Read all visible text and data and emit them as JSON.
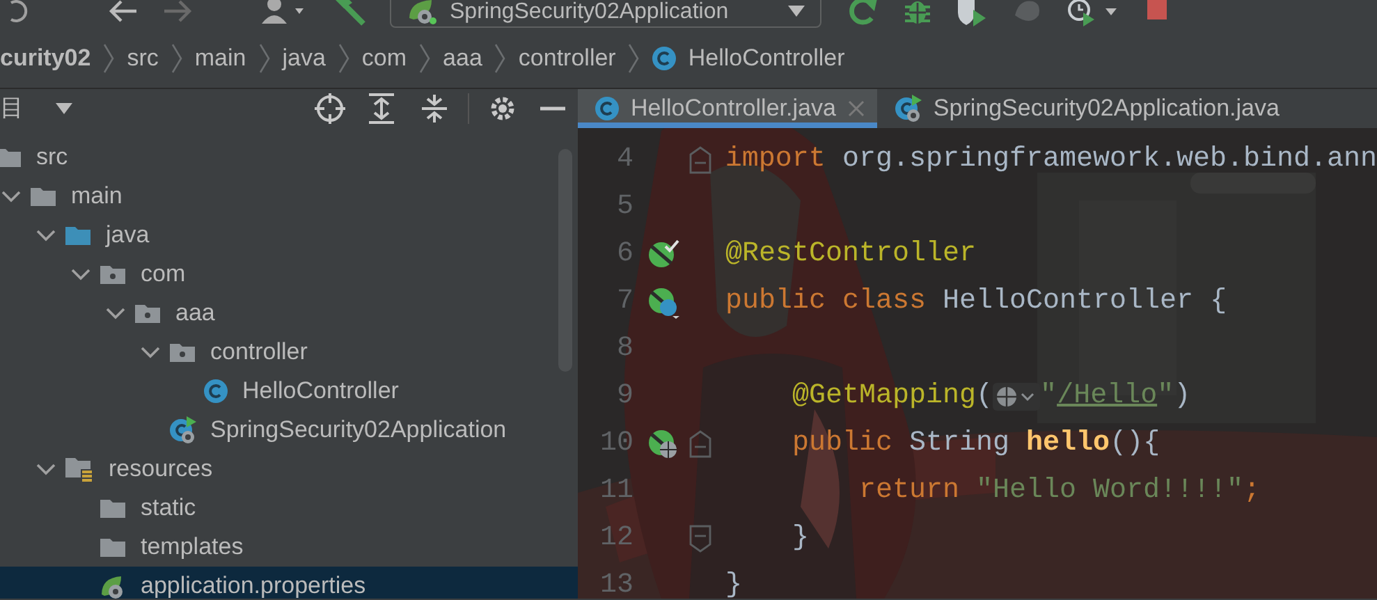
{
  "toolbar": {
    "run_config": "SpringSecurity02Application"
  },
  "breadcrumb": [
    {
      "text": "curity02",
      "kind": "project"
    },
    {
      "text": "src",
      "kind": "dir"
    },
    {
      "text": "main",
      "kind": "dir"
    },
    {
      "text": "java",
      "kind": "dir"
    },
    {
      "text": "com",
      "kind": "dir"
    },
    {
      "text": "aaa",
      "kind": "dir"
    },
    {
      "text": "controller",
      "kind": "dir"
    },
    {
      "text": "HelloController",
      "kind": "class"
    }
  ],
  "project_panel": {
    "title": "目",
    "tree": [
      {
        "label": "src",
        "kind": "folder",
        "selected": false,
        "children": [
          {
            "label": "main",
            "kind": "folder",
            "expanded": true,
            "selected": false,
            "children": [
              {
                "label": "java",
                "kind": "source-folder",
                "expanded": true,
                "selected": false,
                "children": [
                  {
                    "label": "com",
                    "kind": "package",
                    "expanded": true,
                    "selected": false,
                    "children": [
                      {
                        "label": "aaa",
                        "kind": "package",
                        "expanded": true,
                        "selected": false,
                        "children": [
                          {
                            "label": "controller",
                            "kind": "package",
                            "expanded": true,
                            "selected": false,
                            "children": [
                              {
                                "label": "HelloController",
                                "kind": "class",
                                "selected": false
                              }
                            ]
                          },
                          {
                            "label": "SpringSecurity02Application",
                            "kind": "spring-app",
                            "selected": false
                          }
                        ]
                      }
                    ]
                  }
                ]
              },
              {
                "label": "resources",
                "kind": "resources-folder",
                "expanded": true,
                "selected": false,
                "children": [
                  {
                    "label": "static",
                    "kind": "folder",
                    "selected": false
                  },
                  {
                    "label": "templates",
                    "kind": "folder",
                    "selected": false
                  },
                  {
                    "label": "application.properties",
                    "kind": "properties",
                    "selected": true
                  }
                ]
              }
            ]
          }
        ]
      }
    ]
  },
  "tabs": [
    {
      "label": "HelloController.java",
      "kind": "class",
      "selected": true
    },
    {
      "label": "SpringSecurity02Application.java",
      "kind": "spring-app",
      "selected": false
    }
  ],
  "editor": {
    "lines": [
      {
        "number": "4",
        "fold_marker": {
          "kind": "start"
        },
        "tokens": [
          {
            "kind": "keyword",
            "text": "import"
          },
          {
            "kind": "plain",
            "text": " org.springframework.web.bind.ann"
          }
        ]
      },
      {
        "number": "5"
      },
      {
        "number": "6",
        "gutter_icon": {
          "kind": "bean-check"
        },
        "tokens": [
          {
            "kind": "annotation",
            "text": "@RestController"
          }
        ]
      },
      {
        "number": "7",
        "gutter_icon": {
          "kind": "bean-class"
        },
        "tokens": [
          {
            "kind": "keyword",
            "text": "public class"
          },
          {
            "kind": "plain",
            "text": " HelloController {"
          }
        ]
      },
      {
        "number": "8"
      },
      {
        "number": "9",
        "tokens": [
          {
            "kind": "annotation",
            "text": "    @GetMapping"
          },
          {
            "kind": "plain",
            "text": "("
          },
          {
            "kind": "globe-icon"
          },
          {
            "kind": "string",
            "text": "\""
          },
          {
            "kind": "link",
            "text": "/Hello"
          },
          {
            "kind": "string",
            "text": "\""
          },
          {
            "kind": "plain",
            "text": ")"
          }
        ]
      },
      {
        "number": "10",
        "gutter_icon": {
          "kind": "bean-web"
        },
        "fold_marker": {
          "kind": "start"
        },
        "tokens": [
          {
            "kind": "keyword",
            "text": "    public"
          },
          {
            "kind": "plain",
            "text": " String "
          },
          {
            "kind": "method",
            "text": "hello"
          },
          {
            "kind": "plain",
            "text": "(){"
          }
        ]
      },
      {
        "number": "11",
        "tokens": [
          {
            "kind": "keyword",
            "text": "        return "
          },
          {
            "kind": "string",
            "text": "\"Hello Word!!!!\""
          },
          {
            "kind": "keyword",
            "text": ";"
          }
        ]
      },
      {
        "number": "12",
        "fold_marker": {
          "kind": "end"
        },
        "tokens": [
          {
            "kind": "plain",
            "text": "    }"
          }
        ]
      },
      {
        "number": "13",
        "tokens": [
          {
            "kind": "plain",
            "text": "}"
          }
        ]
      }
    ]
  }
}
